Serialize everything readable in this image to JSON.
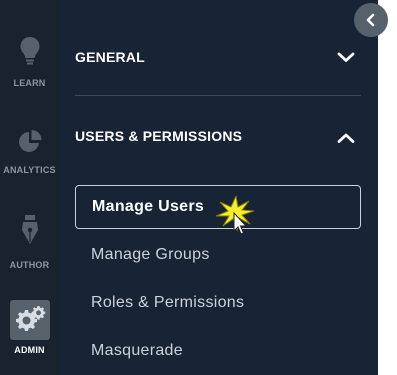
{
  "rail": {
    "items": [
      {
        "label": "LEARN",
        "icon": "lightbulb-icon"
      },
      {
        "label": "ANALYTICS",
        "icon": "pie-chart-icon"
      },
      {
        "label": "AUTHOR",
        "icon": "pen-nib-icon"
      },
      {
        "label": "ADMIN",
        "icon": "gear-icon",
        "active": true
      }
    ]
  },
  "panel": {
    "sections": [
      {
        "title": "GENERAL",
        "state": "collapsed"
      },
      {
        "title": "USERS & PERMISSIONS",
        "state": "expanded"
      }
    ],
    "menu": [
      {
        "label": "Manage Users",
        "selected": true
      },
      {
        "label": "Manage Groups"
      },
      {
        "label": "Roles & Permissions"
      },
      {
        "label": "Masquerade"
      }
    ]
  },
  "colors": {
    "rail_bg": "#19232f",
    "panel_bg": "#162435",
    "admin_active_bg": "#56616c",
    "divider": "#3a4857",
    "selected_border": "#c9d1da"
  }
}
